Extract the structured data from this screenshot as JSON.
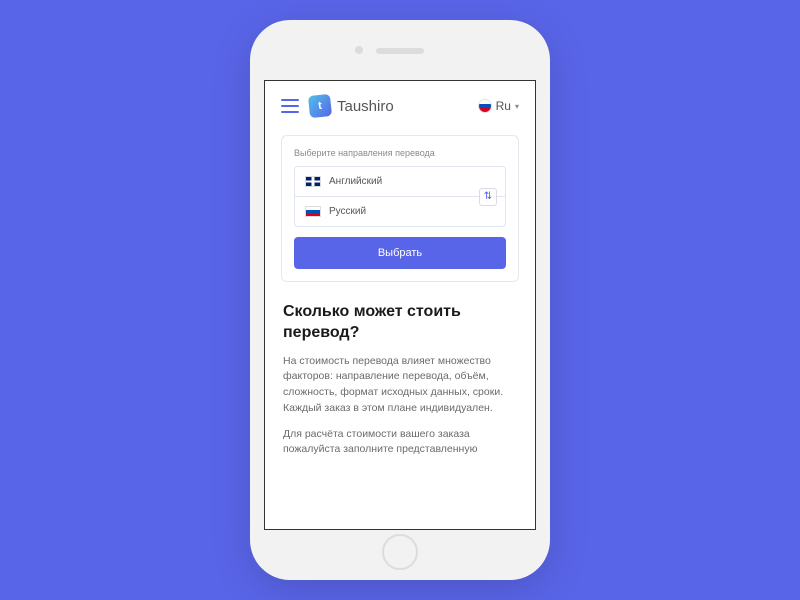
{
  "header": {
    "brand": "Taushiro",
    "langLabel": "Ru"
  },
  "card": {
    "title": "Выберите направления перевода",
    "sourceLang": "Английский",
    "targetLang": "Русский",
    "button": "Выбрать"
  },
  "article": {
    "heading": "Сколько может стоить перевод?",
    "p1": "На стоимость перевода влияет множество факторов: направление перевода, объём, сложность, формат исходных данных, сроки. Каждый заказ в этом плане индивидуален.",
    "p2": "Для расчёта стоимости вашего заказа пожалуйста заполните представленную"
  }
}
